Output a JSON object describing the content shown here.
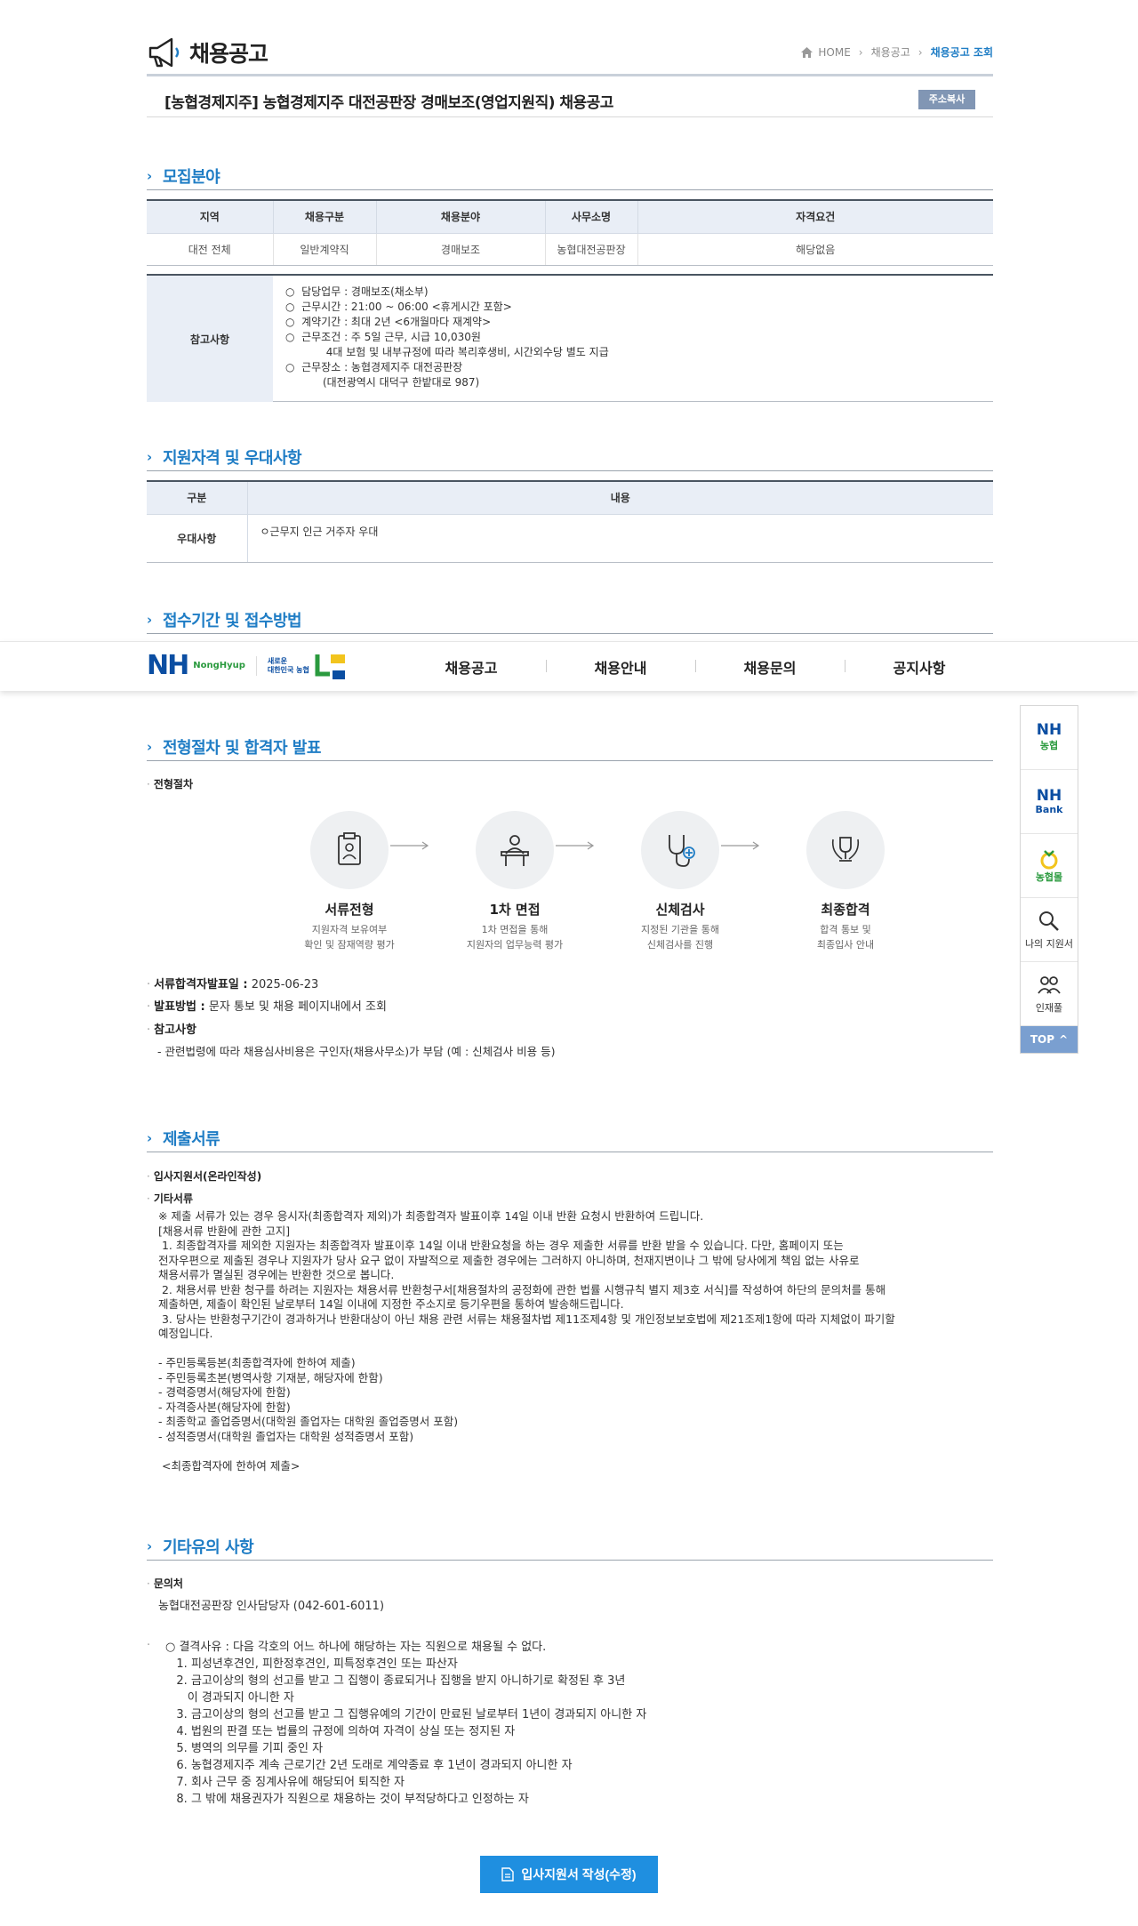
{
  "header": {
    "title": "채용공고",
    "breadcrumb": [
      "HOME",
      "채용공고",
      "채용공고 조회"
    ]
  },
  "post": {
    "title": "[농협경제지주] 농협경제지주 대전공판장 경매보조(영업지원직) 채용공고",
    "copy_label": "주소복사"
  },
  "sections": {
    "recruit": "모집분야",
    "qualification": "지원자격 및 우대사항",
    "period": "접수기간 및 접수방법",
    "procedure": "전형절차 및 합격자 발표",
    "documents": "제출서류",
    "etc": "기타유의 사항"
  },
  "recruit_table": {
    "headers": [
      "지역",
      "채용구분",
      "채용분야",
      "사무소명",
      "자격요건"
    ],
    "row": [
      "대전 전체",
      "일반계약직",
      "경매보조",
      "농협대전공판장",
      "해당없음"
    ]
  },
  "note": {
    "label": "참고사항",
    "lines": [
      "○  담당업무 : 경매보조(채소부)",
      "○  근무시간 : 21:00 ~ 06:00 <휴게시간 포함>",
      "○  계약기간 : 최대 2년 <6개월마다 재계약>",
      "○  근무조건 : 주 5일 근무, 시급 10,030원",
      "            4대 보험 및 내부규정에 따라 복리후생비, 시간외수당 별도 지급",
      "○  근무장소 : 농협경제지주 대전공판장",
      "           (대전광역시 대덕구 한밭대로 987)"
    ]
  },
  "qual_table": {
    "headers": [
      "구분",
      "내용"
    ],
    "label": "우대사항",
    "content": "ㅇ근무지 인근 거주자 우대"
  },
  "gnb": {
    "brand": "NH",
    "brand_sub": "NongHyup",
    "slogan_1": "새로운",
    "slogan_2": "대한민국 농협",
    "menu": [
      "채용공고",
      "채용안내",
      "채용문의",
      "공지사항"
    ]
  },
  "quick": {
    "items": [
      {
        "top": "NH",
        "sub": "농협"
      },
      {
        "top": "NH",
        "sub": "Bank"
      },
      {
        "top": "",
        "sub": "농협몰"
      },
      {
        "top": "",
        "sub": "나의 지원서"
      },
      {
        "top": "",
        "sub": "인재풀"
      }
    ],
    "top_label": "TOP"
  },
  "procedure": {
    "label": "전형절차",
    "steps": [
      {
        "title": "서류전형",
        "desc1": "지원자격 보유여부",
        "desc2": "확인 및 잠재역량 평가"
      },
      {
        "title": "1차 면접",
        "desc1": "1차 면접을 통해",
        "desc2": "지원자의 업무능력 평가"
      },
      {
        "title": "신체검사",
        "desc1": "지정된 기관을 통해",
        "desc2": "신체검사를 진행"
      },
      {
        "title": "최종합격",
        "desc1": "합격 통보 및",
        "desc2": "최종입사 안내"
      }
    ],
    "announce_label": "서류합격자발표일 :",
    "announce_date": "2025-06-23",
    "method_label": "발표방법 :",
    "method_value": "문자 통보 및 채용 페이지내에서 조회",
    "note_label": "참고사항",
    "note_text": "- 관련법령에 따라 채용심사비용은 구인자(채용사무소)가 부담 (예 : 신체검사 비용 등)"
  },
  "documents": {
    "online_label": "입사지원서(온라인작성)",
    "other_label": "기타서류",
    "body": "※ 제출 서류가 있는 경우 응시자(최종합격자 제외)가 최종합격자 발표이후 14일 이내 반환 요청시 반환하여 드립니다.\n[채용서류 반환에 관한 고지]\n 1. 최종합격자를 제외한 지원자는 최종합격자 발표이후 14일 이내 반환요청을 하는 경우 제출한 서류를 반환 받을 수 있습니다. 다만, 홈페이지 또는\n전자우편으로 제출된 경우나 지원자가 당사 요구 없이 자발적으로 제출한 경우에는 그러하지 아니하며, 천재지변이나 그 밖에 당사에게 책임 없는 사유로\n채용서류가 멸실된 경우에는 반환한 것으로 봅니다.\n 2. 채용서류 반환 청구를 하려는 지원자는 채용서류 반환청구서[채용절차의 공정화에 관한 법률 시행규칙 별지 제3호 서식]를 작성하여 하단의 문의처를 통해\n제출하면, 제출이 확인된 날로부터 14일 이내에 지정한 주소지로 등기우편을 통하여 발송해드립니다.\n 3. 당사는 반환청구기간이 경과하거나 반환대상이 아닌 채용 관련 서류는 채용절차법 제11조제4항 및 개인정보보호법에 제21조제1항에 따라 지체없이 파기할\n예정입니다.\n\n- 주민등록등본(최종합격자에 한하여 제출)\n- 주민등록초본(병역사항 기재분, 해당자에 한함)\n- 경력증명서(해당자에 한함)\n- 자격증사본(해당자에 한함)\n- 최종학교 졸업증명서(대학원 졸업자는 대학원 졸업증명서 포함)\n- 성적증명서(대학원 졸업자는 대학원 성적증명서 포함)\n\n <최종합격자에 한하여 제출>"
  },
  "etc": {
    "contact_label": "문의처",
    "contact_value": "농협대전공판장 인사담당자 (042-601-6011)",
    "body": "○ 결격사유 : 다음 각호의 어느 하나에 해당하는 자는 직원으로 채용될 수 없다.\n   1. 피성년후견인, 피한정후견인, 피특정후견인 또는 파산자\n   2. 금고이상의 형의 선고를 받고 그 집행이 종료되거나 집행을 받지 아니하기로 확정된 후 3년\n      이 경과되지 아니한 자\n   3. 금고이상의 형의 선고를 받고 그 집행유예의 기간이 만료된 날로부터 1년이 경과되지 아니한 자\n   4. 법원의 판결 또는 법률의 규정에 의하여 자격이 상실 또는 정지된 자\n   5. 병역의 의무를 기피 중인 자\n   6. 농협경제지주 계속 근로기간 2년 도래로 계약종료 후 1년이 경과되지 아니한 자\n   7. 회사 근무 중 징계사유에 해당되어 퇴직한 자\n   8. 그 밖에 채용권자가 직원으로 채용하는 것이 부적당하다고 인정하는 자"
  },
  "apply": {
    "label": "입사지원서 작성(수정)"
  }
}
